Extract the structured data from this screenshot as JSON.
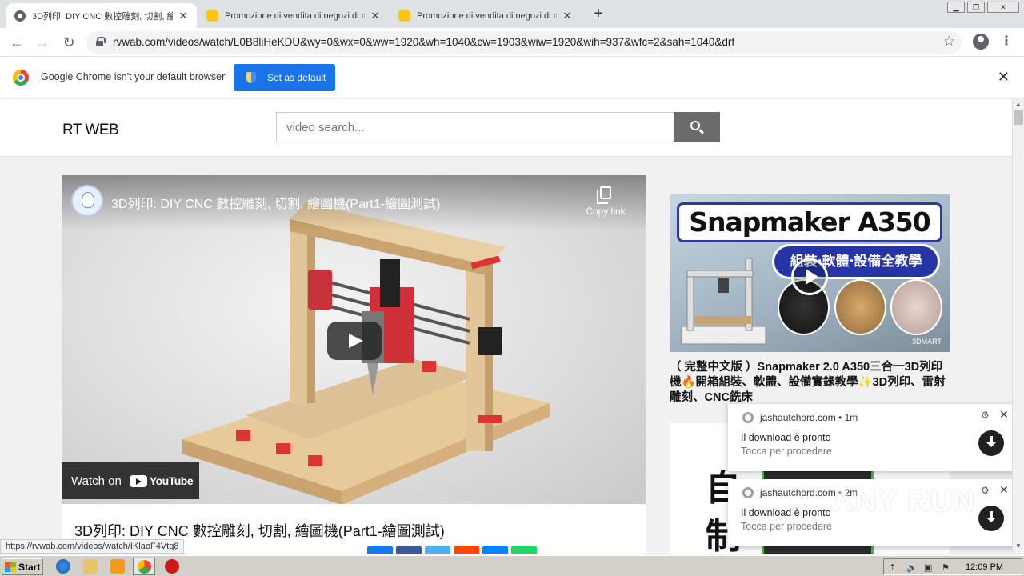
{
  "browser": {
    "tabs": [
      {
        "title": "3D列印: DIY CNC 數控雕刻, 切割, 繪",
        "active": true,
        "icon": "chrome-circle-icon"
      },
      {
        "title": "Promozione di vendita di negozi di m",
        "active": false,
        "icon": "smiley-icon"
      },
      {
        "title": "Promozione di vendita di negozi di m",
        "active": false,
        "icon": "smiley-icon"
      }
    ],
    "new_tab": "+",
    "url": "rvwab.com/videos/watch/L0B8liHeKDU&wy=0&wx=0&ww=1920&wh=1040&cw=1903&wiw=1920&wih=937&wfc=2&sah=1040&drf",
    "infobar": {
      "message": "Google Chrome isn't your default browser",
      "button": "Set as default"
    },
    "status_url": "https://rvwab.com/videos/watch/IKlaoF4Vtq8"
  },
  "site": {
    "title": "RT WEB",
    "search_placeholder": "video search..."
  },
  "player": {
    "title": "3D列印: DIY CNC 數控雕刻, 切割, 繪圖機(Part1-繪圖測試)",
    "copy_link": "Copy link",
    "watch_on": "Watch on",
    "youtube": "YouTube"
  },
  "page_video_title": "3D列印: DIY CNC 數控雕刻, 切割, 繪圖機(Part1-繪圖測試)",
  "share_colors": [
    "#1877f2",
    "#3b5998",
    "#55acee",
    "#ff4500",
    "#0084ff",
    "#25d366"
  ],
  "sidebar": {
    "thumb_banner": "Snapmaker A350",
    "thumb_pill": "組裝‧軟體‧設備全教學",
    "thumb_mark": "3DMART",
    "video_title": "（ 完整中文版 ）Snapmaker 2.0 A350三合一3D列印機🔥開箱組裝、軟體、設備實錄教學✨3D列印、雷射雕刻、CNC銑床",
    "thumb2_chars": [
      "自",
      "制"
    ]
  },
  "notifications": [
    {
      "site": "jashautchord.com",
      "time": "1m",
      "title": "Il download è pronto",
      "body": "Tocca per procedere"
    },
    {
      "site": "jashautchord.com",
      "time": "2m",
      "title": "Il download è pronto",
      "body": "Tocca per procedere"
    }
  ],
  "watermark": "ANY RUN",
  "taskbar": {
    "start": "Start",
    "clock": "12:09 PM"
  }
}
